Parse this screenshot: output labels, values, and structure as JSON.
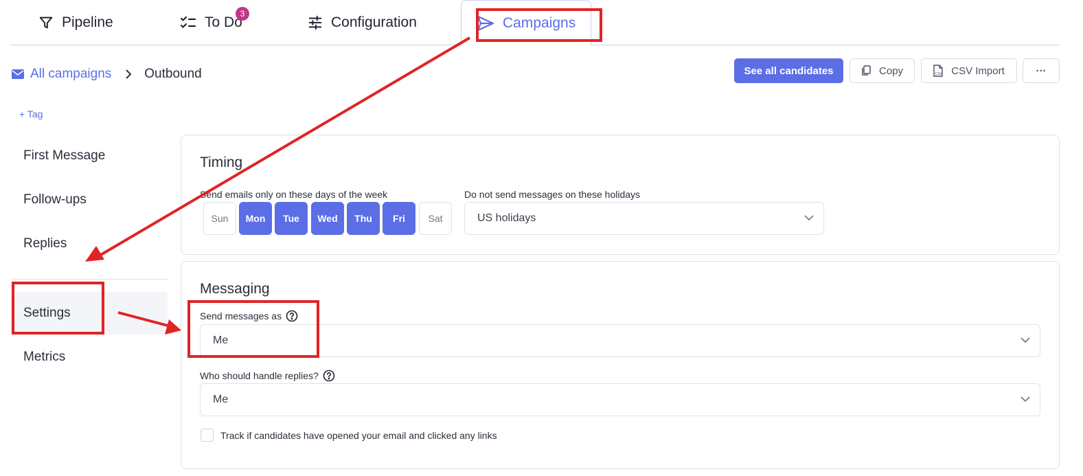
{
  "tabs": [
    {
      "label": "Pipeline",
      "icon": "filter-icon"
    },
    {
      "label": "To Do",
      "icon": "checklist-icon",
      "badge": "3"
    },
    {
      "label": "Configuration",
      "icon": "sliders-icon"
    },
    {
      "label": "Campaigns",
      "icon": "send-icon",
      "active": true
    }
  ],
  "breadcrumb": {
    "parent": "All campaigns",
    "current": "Outbound"
  },
  "toolbar": {
    "see_all": "See all candidates",
    "copy": "Copy",
    "csv_import": "CSV Import",
    "more": "···"
  },
  "add_tag": "+ Tag",
  "nav": [
    {
      "label": "First Message"
    },
    {
      "label": "Follow-ups"
    },
    {
      "label": "Replies"
    },
    {
      "label": "Settings",
      "active": true
    },
    {
      "label": "Metrics"
    }
  ],
  "timing": {
    "title": "Timing",
    "days_label": "Send emails only on these days of the week",
    "days": [
      {
        "label": "Sun",
        "selected": false
      },
      {
        "label": "Mon",
        "selected": true
      },
      {
        "label": "Tue",
        "selected": true
      },
      {
        "label": "Wed",
        "selected": true
      },
      {
        "label": "Thu",
        "selected": true
      },
      {
        "label": "Fri",
        "selected": true
      },
      {
        "label": "Sat",
        "selected": false
      }
    ],
    "holidays_label": "Do not send messages on these holidays",
    "holidays_value": "US holidays"
  },
  "messaging": {
    "title": "Messaging",
    "send_as_label": "Send messages as",
    "send_as_value": "Me",
    "replies_label": "Who should handle replies?",
    "replies_value": "Me",
    "track_label": "Track if candidates have opened your email and clicked any links"
  },
  "colors": {
    "accent": "#5b6ee6",
    "badge": "#c2378a",
    "annotation": "#e02424"
  }
}
